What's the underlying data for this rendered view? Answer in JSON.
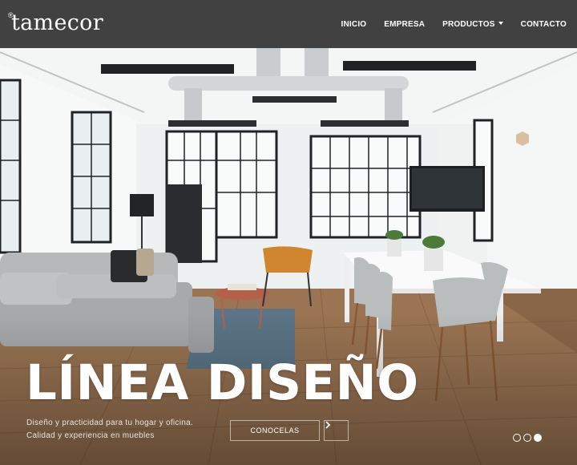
{
  "header": {
    "logo_text": "tamecor",
    "logo_mark": "®",
    "nav": [
      {
        "label": "INICIO"
      },
      {
        "label": "EMPRESA"
      },
      {
        "label": "PRODUCTOS"
      },
      {
        "label": "CONTACTO"
      }
    ]
  },
  "hero": {
    "title": "LÍNEA DISEÑO",
    "subtitle_lines": [
      "Diseño y practicidad para tu hogar y oficina.",
      "Calidad y experiencia en muebles"
    ],
    "cta_label": "CONOCELAS",
    "next_icon": "chevron-right-icon",
    "slides": [
      {
        "active": false
      },
      {
        "active": false
      },
      {
        "active": true
      }
    ]
  },
  "colors": {
    "navbar_bg": "#414141",
    "nav_text": "#ffffff",
    "hero_title": "#ffffff"
  }
}
